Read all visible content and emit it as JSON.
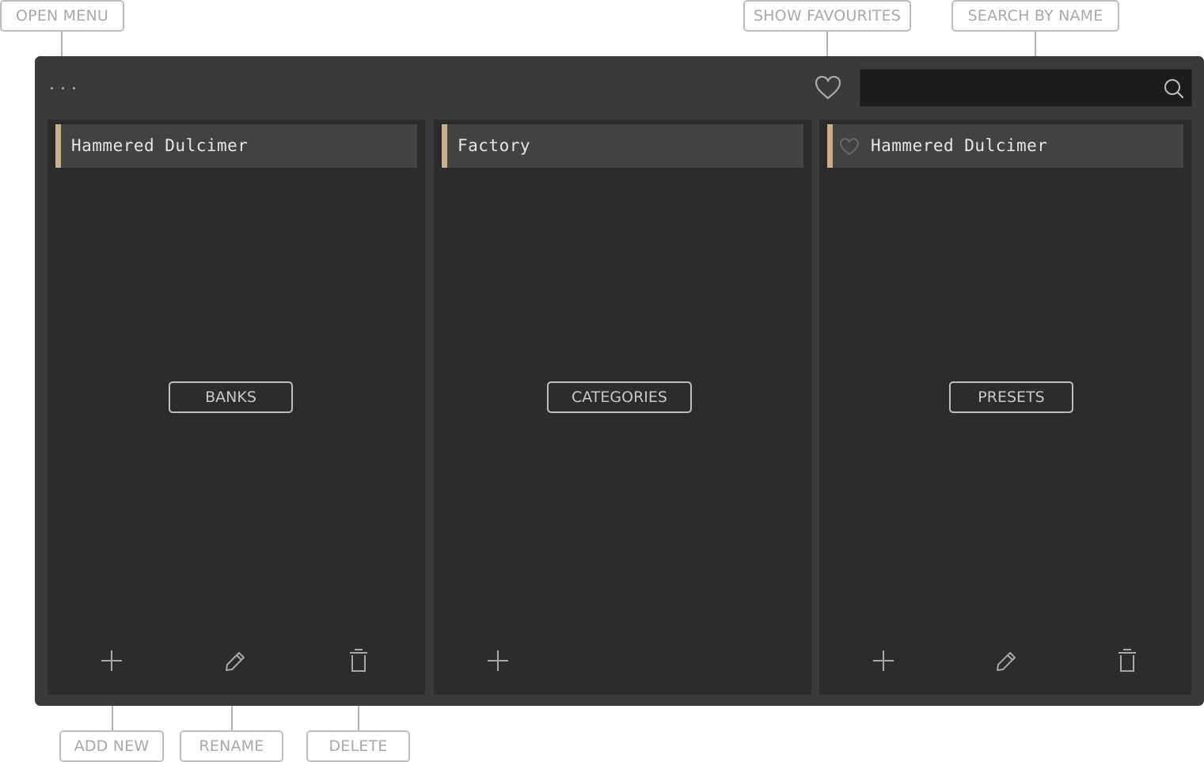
{
  "callouts": {
    "open_menu": "OPEN MENU",
    "show_favourites": "SHOW FAVOURITES",
    "search_by_name": "SEARCH BY NAME",
    "add_new": "ADD NEW",
    "rename": "RENAME",
    "delete": "DELETE"
  },
  "toolbar": {
    "menu_icon": "ellipsis-icon",
    "favourites_icon": "heart-icon",
    "search_icon": "search-icon",
    "search_value": "",
    "search_placeholder": ""
  },
  "panels": [
    {
      "label": "BANKS",
      "selected_item": "Hammered Dulcimer",
      "tools": [
        "plus-icon",
        "pencil-icon",
        "trash-icon"
      ]
    },
    {
      "label": "CATEGORIES",
      "selected_item": "Factory",
      "tools": [
        "plus-icon"
      ]
    },
    {
      "label": "PRESETS",
      "selected_item": "Hammered Dulcimer",
      "item_icon": "heart-icon",
      "tools": [
        "plus-icon",
        "pencil-icon",
        "trash-icon"
      ]
    }
  ],
  "colors": {
    "background": "#3a3a3a",
    "panel": "#2c2c2c",
    "row": "#434240",
    "accent": "#c9b08c",
    "search_field": "#1c1c1c",
    "callout_border": "#bdbdbd"
  }
}
